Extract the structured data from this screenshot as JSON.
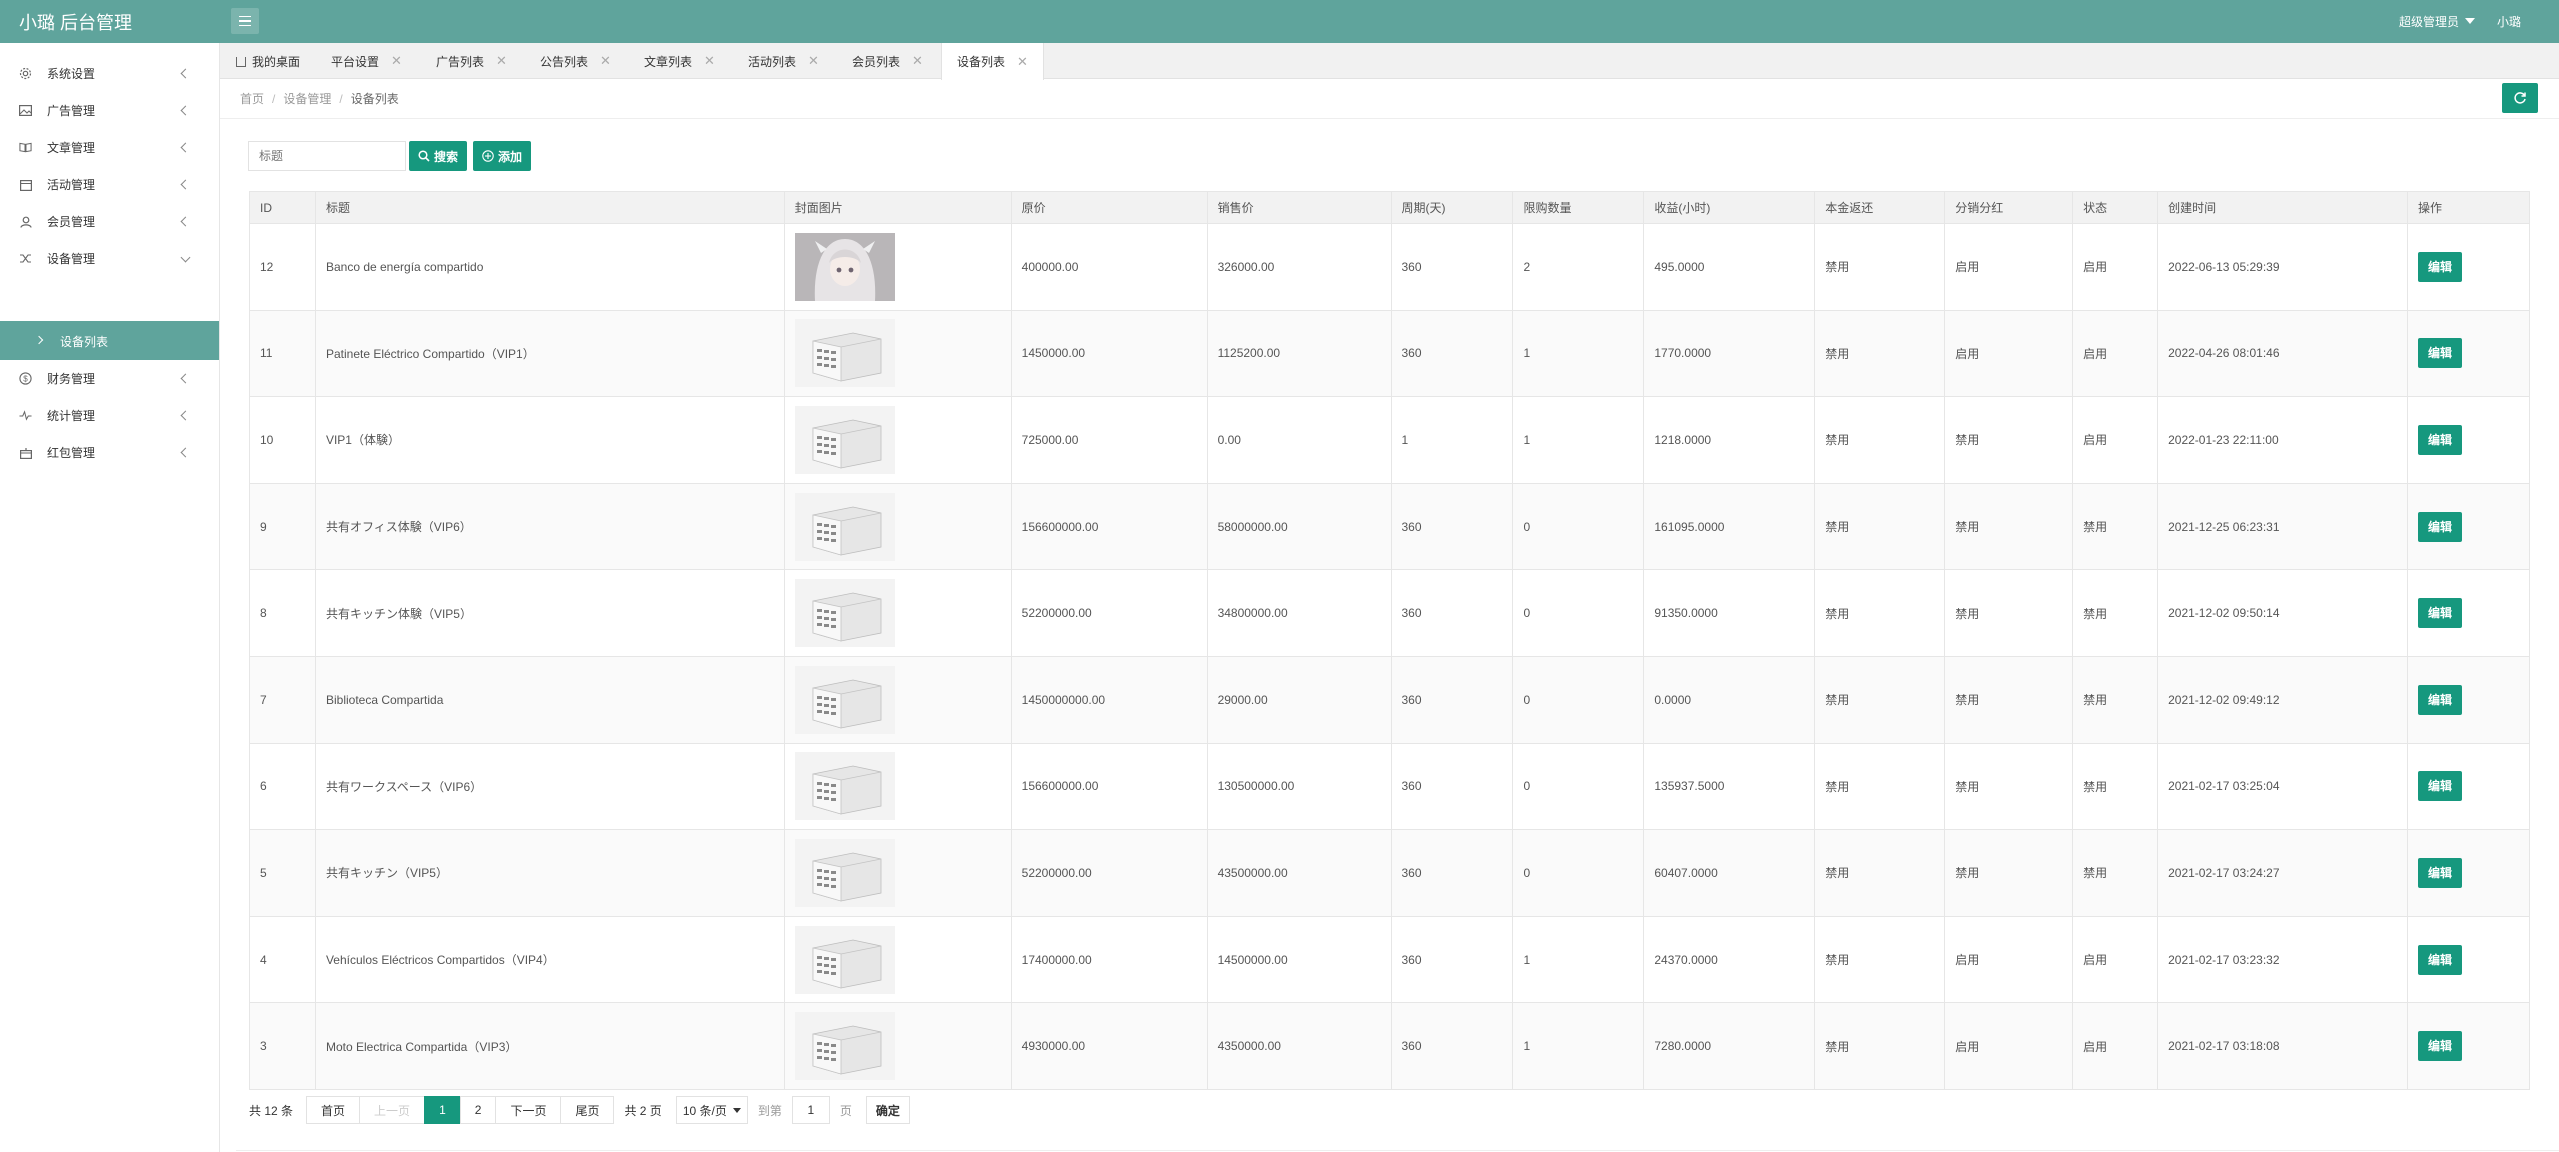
{
  "header": {
    "logo": "小璐 后台管理",
    "role": "超级管理员",
    "user": "小璐"
  },
  "sidebar": {
    "items": [
      {
        "label": "系统设置",
        "icon": "gear-icon"
      },
      {
        "label": "广告管理",
        "icon": "image-icon"
      },
      {
        "label": "文章管理",
        "icon": "book-icon"
      },
      {
        "label": "活动管理",
        "icon": "calendar-icon"
      },
      {
        "label": "会员管理",
        "icon": "user-icon"
      },
      {
        "label": "设备管理",
        "icon": "shuffle-icon"
      },
      {
        "label": "财务管理",
        "icon": "dollar-icon"
      },
      {
        "label": "统计管理",
        "icon": "pulse-icon"
      },
      {
        "label": "红包管理",
        "icon": "gift-icon"
      }
    ],
    "active_sub": "设备列表"
  },
  "tabs": [
    {
      "label": "我的桌面"
    },
    {
      "label": "平台设置"
    },
    {
      "label": "广告列表"
    },
    {
      "label": "公告列表"
    },
    {
      "label": "文章列表"
    },
    {
      "label": "活动列表"
    },
    {
      "label": "会员列表"
    },
    {
      "label": "设备列表"
    }
  ],
  "breadcrumb": {
    "home": "首页",
    "parent": "设备管理",
    "current": "设备列表"
  },
  "search": {
    "placeholder": "标题",
    "search_label": "搜索",
    "add_label": "添加"
  },
  "table": {
    "columns": [
      "ID",
      "标题",
      "封面图片",
      "原价",
      "销售价",
      "周期(天)",
      "限购数量",
      "收益(小时)",
      "本金返还",
      "分销分红",
      "状态",
      "创建时间",
      "操作"
    ],
    "edit_label": "编辑",
    "rows": [
      {
        "id": "12",
        "title": "Banco de energía compartido",
        "cover": "anime",
        "price": "400000.00",
        "sale": "326000.00",
        "cycle": "360",
        "limit": "2",
        "income": "495.0000",
        "refund": "禁用",
        "refund_on": false,
        "dividend": "启用",
        "dividend_on": true,
        "status": "启用",
        "status_on": true,
        "created": "2022-06-13 05:29:39"
      },
      {
        "id": "11",
        "title": "Patinete Eléctrico Compartido（VIP1）",
        "cover": "cabinet",
        "price": "1450000.00",
        "sale": "1125200.00",
        "cycle": "360",
        "limit": "1",
        "income": "1770.0000",
        "refund": "禁用",
        "refund_on": false,
        "dividend": "启用",
        "dividend_on": true,
        "status": "启用",
        "status_on": true,
        "created": "2022-04-26 08:01:46"
      },
      {
        "id": "10",
        "title": "VIP1（体験）",
        "cover": "cabinet",
        "price": "725000.00",
        "sale": "0.00",
        "cycle": "1",
        "limit": "1",
        "income": "1218.0000",
        "refund": "禁用",
        "refund_on": false,
        "dividend": "禁用",
        "dividend_on": false,
        "status": "启用",
        "status_on": true,
        "created": "2022-01-23 22:11:00"
      },
      {
        "id": "9",
        "title": "共有オフィス体験（VIP6）",
        "cover": "cabinet",
        "price": "156600000.00",
        "sale": "58000000.00",
        "cycle": "360",
        "limit": "0",
        "income": "161095.0000",
        "refund": "禁用",
        "refund_on": false,
        "dividend": "禁用",
        "dividend_on": false,
        "status": "禁用",
        "status_on": false,
        "created": "2021-12-25 06:23:31"
      },
      {
        "id": "8",
        "title": "共有キッチン体験（VIP5）",
        "cover": "cabinet",
        "price": "52200000.00",
        "sale": "34800000.00",
        "cycle": "360",
        "limit": "0",
        "income": "91350.0000",
        "refund": "禁用",
        "refund_on": false,
        "dividend": "禁用",
        "dividend_on": false,
        "status": "禁用",
        "status_on": false,
        "created": "2021-12-02 09:50:14"
      },
      {
        "id": "7",
        "title": "Biblioteca Compartida",
        "cover": "cabinet",
        "price": "1450000000.00",
        "sale": "29000.00",
        "cycle": "360",
        "limit": "0",
        "income": "0.0000",
        "refund": "禁用",
        "refund_on": false,
        "dividend": "禁用",
        "dividend_on": false,
        "status": "禁用",
        "status_on": false,
        "created": "2021-12-02 09:49:12"
      },
      {
        "id": "6",
        "title": "共有ワークスペース（VIP6）",
        "cover": "cabinet",
        "price": "156600000.00",
        "sale": "130500000.00",
        "cycle": "360",
        "limit": "0",
        "income": "135937.5000",
        "refund": "禁用",
        "refund_on": false,
        "dividend": "禁用",
        "dividend_on": false,
        "status": "禁用",
        "status_on": false,
        "created": "2021-02-17 03:25:04"
      },
      {
        "id": "5",
        "title": "共有キッチン（VIP5）",
        "cover": "cabinet",
        "price": "52200000.00",
        "sale": "43500000.00",
        "cycle": "360",
        "limit": "0",
        "income": "60407.0000",
        "refund": "禁用",
        "refund_on": false,
        "dividend": "禁用",
        "dividend_on": false,
        "status": "禁用",
        "status_on": false,
        "created": "2021-02-17 03:24:27"
      },
      {
        "id": "4",
        "title": "Vehículos Eléctricos Compartidos（VIP4）",
        "cover": "cabinet",
        "price": "17400000.00",
        "sale": "14500000.00",
        "cycle": "360",
        "limit": "1",
        "income": "24370.0000",
        "refund": "禁用",
        "refund_on": false,
        "dividend": "启用",
        "dividend_on": true,
        "status": "启用",
        "status_on": true,
        "created": "2021-02-17 03:23:32"
      },
      {
        "id": "3",
        "title": "Moto Electrica Compartida（VIP3）",
        "cover": "cabinet",
        "price": "4930000.00",
        "sale": "4350000.00",
        "cycle": "360",
        "limit": "1",
        "income": "7280.0000",
        "refund": "禁用",
        "refund_on": false,
        "dividend": "启用",
        "dividend_on": true,
        "status": "启用",
        "status_on": true,
        "created": "2021-02-17 03:18:08"
      }
    ]
  },
  "pagination": {
    "total": "共 12 条",
    "first": "首页",
    "prev": "上一页",
    "pages": [
      "1",
      "2"
    ],
    "current": "1",
    "next": "下一页",
    "last": "尾页",
    "page_count": "共 2 页",
    "page_size": "10 条/页",
    "goto": "到第",
    "goto_value": "1",
    "page_unit": "页",
    "confirm": "确定"
  },
  "colors": {
    "header": "#5fa49c",
    "primary": "#16987e",
    "enabled": "#3e9f45",
    "disabled": "#aaaaaa"
  }
}
